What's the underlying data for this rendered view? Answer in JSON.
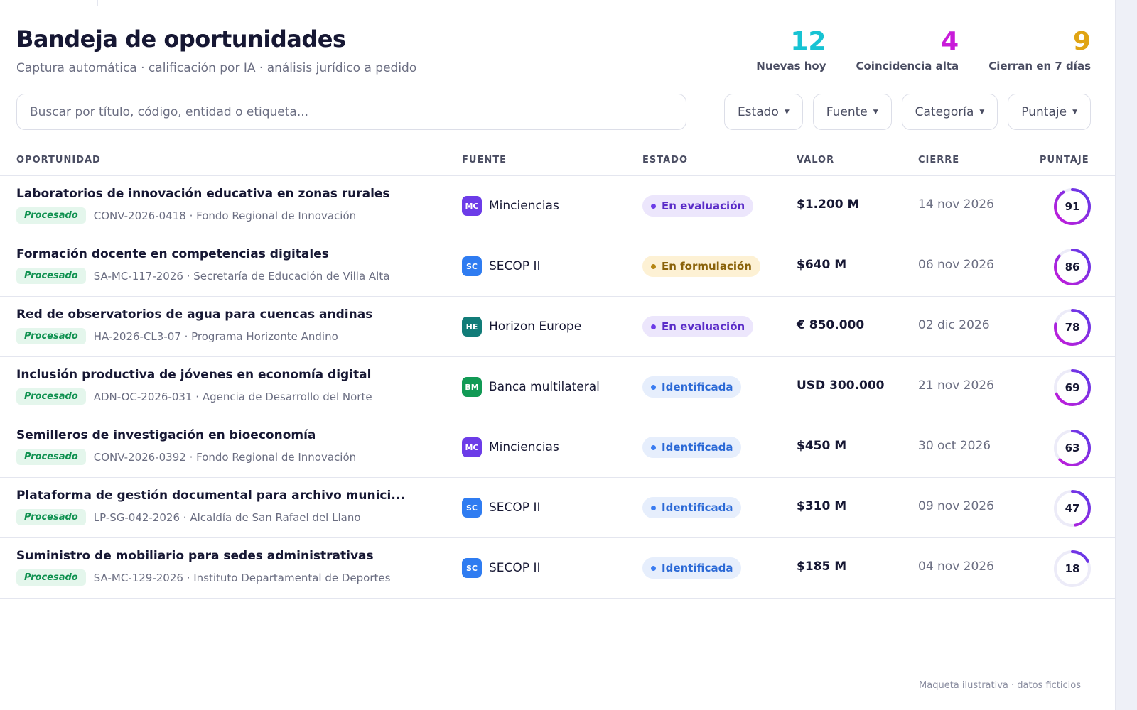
{
  "header": {
    "title": "Bandeja de oportunidades",
    "subtitle": "Captura automática · calificación por IA · análisis jurídico a pedido"
  },
  "stats": [
    {
      "value": "12",
      "label": "Nuevas hoy",
      "color": "#17c3d3"
    },
    {
      "value": "4",
      "label": "Coincidencia alta",
      "color": "#c81bd9"
    },
    {
      "value": "9",
      "label": "Cierran en 7 días",
      "color": "#e0a413"
    }
  ],
  "search": {
    "placeholder": "Buscar por título, código, entidad o etiqueta..."
  },
  "filters": [
    "Estado",
    "Fuente",
    "Categoría",
    "Puntaje"
  ],
  "columns": {
    "opportunity": "OPORTUNIDAD",
    "source": "FUENTE",
    "status": "ESTADO",
    "value": "VALOR",
    "close": "CIERRE",
    "score": "PUNTAJE"
  },
  "source_colors": {
    "MC": "#6c3ce8",
    "SC": "#2f7cf1",
    "HE": "#117c78",
    "BM": "#119a55"
  },
  "status_styles": {
    "En evaluación": {
      "bg": "#ece6fc",
      "fg": "#5a2cc8",
      "dot": "#6c3ce8"
    },
    "En formulación": {
      "bg": "#fdf1d4",
      "fg": "#8a6209",
      "dot": "#b58612"
    },
    "Identificada": {
      "bg": "#e6eefc",
      "fg": "#2b69d6",
      "dot": "#3a7cf1"
    }
  },
  "rows": [
    {
      "title": "Laboratorios de innovación educativa en zonas rurales",
      "badge": "Procesado",
      "code": "CONV-2026-0418 · Fondo Regional de Innovación",
      "source_abbr": "MC",
      "source": "Minciencias",
      "status": "En evaluación",
      "value": "$1.200 M",
      "close": "14 nov 2026",
      "score": 91
    },
    {
      "title": "Formación docente en competencias digitales",
      "badge": "Procesado",
      "code": "SA-MC-117-2026 · Secretaría de Educación de Villa Alta",
      "source_abbr": "SC",
      "source": "SECOP II",
      "status": "En formulación",
      "value": "$640 M",
      "close": "06 nov 2026",
      "score": 86
    },
    {
      "title": "Red de observatorios de agua para cuencas andinas",
      "badge": "Procesado",
      "code": "HA-2026-CL3-07 · Programa Horizonte Andino",
      "source_abbr": "HE",
      "source": "Horizon Europe",
      "status": "En evaluación",
      "value": "€ 850.000",
      "close": "02 dic 2026",
      "score": 78
    },
    {
      "title": "Inclusión productiva de jóvenes en economía digital",
      "badge": "Procesado",
      "code": "ADN-OC-2026-031 · Agencia de Desarrollo del Norte",
      "source_abbr": "BM",
      "source": "Banca multilateral",
      "status": "Identificada",
      "value": "USD 300.000",
      "close": "21 nov 2026",
      "score": 69
    },
    {
      "title": "Semilleros de investigación en bioeconomía",
      "badge": "Procesado",
      "code": "CONV-2026-0392 · Fondo Regional de Innovación",
      "source_abbr": "MC",
      "source": "Minciencias",
      "status": "Identificada",
      "value": "$450 M",
      "close": "30 oct 2026",
      "score": 63
    },
    {
      "title": "Plataforma de gestión documental para archivo munici...",
      "badge": "Procesado",
      "code": "LP-SG-042-2026 · Alcaldía de San Rafael del Llano",
      "source_abbr": "SC",
      "source": "SECOP II",
      "status": "Identificada",
      "value": "$310 M",
      "close": "09 nov 2026",
      "score": 47
    },
    {
      "title": "Suministro de mobiliario para sedes administrativas",
      "badge": "Procesado",
      "code": "SA-MC-129-2026 · Instituto Departamental de Deportes",
      "source_abbr": "SC",
      "source": "SECOP II",
      "status": "Identificada",
      "value": "$185 M",
      "close": "04 nov 2026",
      "score": 18
    }
  ],
  "score_ring": {
    "track": "#ecebf8",
    "start": "#c81bd9",
    "end": "#5b3be8"
  },
  "footnote": "Maqueta ilustrativa · datos ficticios"
}
